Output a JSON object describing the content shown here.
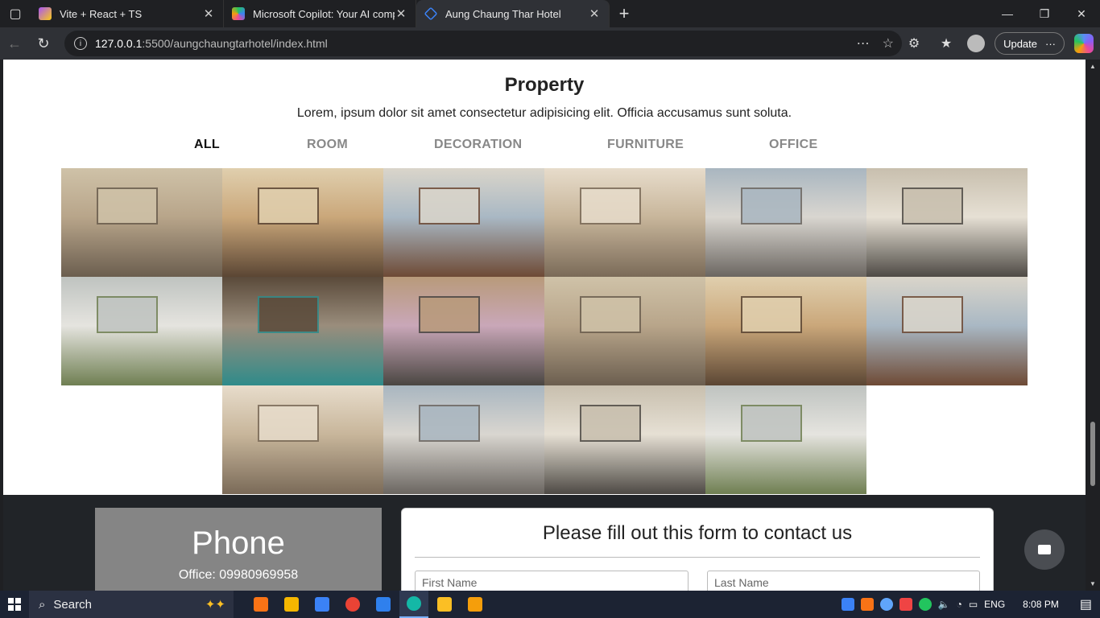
{
  "browser": {
    "tabs": [
      {
        "label": "Vite + React + TS",
        "icon": "vite-icon",
        "color": "#a855f7"
      },
      {
        "label": "Microsoft Copilot: Your AI compa",
        "icon": "copilot-icon",
        "color": "#22c55e"
      },
      {
        "label": "Aung Chaung Thar Hotel",
        "icon": "page-icon",
        "color": "#3b82f6"
      }
    ],
    "url_host": "127.0.0.1",
    "url_path": ":5500/aungchaungtarhotel/index.html",
    "update_label": "Update",
    "more_label": "···"
  },
  "page": {
    "title": "Property",
    "subtitle": "Lorem, ipsum dolor sit amet consectetur adipisicing elit. Officia accusamus sunt soluta.",
    "filters": [
      {
        "label": "ALL",
        "active": true
      },
      {
        "label": "ROOM",
        "active": false
      },
      {
        "label": "DECORATION",
        "active": false
      },
      {
        "label": "FURNITURE",
        "active": false
      },
      {
        "label": "OFFICE",
        "active": false
      }
    ],
    "gallery": [
      {
        "name": "living-room-photo",
        "colors": [
          "#b8a58a",
          "#6b5e4f",
          "#cfc2a8"
        ]
      },
      {
        "name": "kitchen-bar-photo",
        "colors": [
          "#caa77a",
          "#5b4634",
          "#e0cfae"
        ]
      },
      {
        "name": "open-kitchen-photo",
        "colors": [
          "#a9b8c4",
          "#6e4a35",
          "#dad5ca"
        ]
      },
      {
        "name": "lounge-photo",
        "colors": [
          "#c8b69b",
          "#7a6a58",
          "#e7dccb"
        ]
      },
      {
        "name": "bedroom-photo",
        "colors": [
          "#d9d6d0",
          "#6b6661",
          "#a9b6c0"
        ]
      },
      {
        "name": "bathroom-photo",
        "colors": [
          "#e6e0d4",
          "#4e4a45",
          "#c8bfae"
        ]
      },
      {
        "name": "sunroom-photo",
        "colors": [
          "#e5e4df",
          "#6f7f52",
          "#bfc3c0"
        ]
      },
      {
        "name": "billiard-room-photo",
        "colors": [
          "#9a8d7c",
          "#2f8b8a",
          "#5a4a3a"
        ]
      },
      {
        "name": "house-exterior-photo",
        "colors": [
          "#c9a7b8",
          "#4a4642",
          "#b89a7a"
        ]
      },
      {
        "name": "living-room-photo-2",
        "colors": [
          "#b8a58a",
          "#6b5e4f",
          "#cfc2a8"
        ]
      },
      {
        "name": "kitchen-bar-photo-2",
        "colors": [
          "#caa77a",
          "#5b4634",
          "#e0cfae"
        ]
      },
      {
        "name": "open-kitchen-photo-2",
        "colors": [
          "#a9b8c4",
          "#6e4a35",
          "#dad5ca"
        ]
      },
      {
        "name": "lounge-photo-2",
        "colors": [
          "#c8b69b",
          "#7a6a58",
          "#e7dccb"
        ]
      },
      {
        "name": "bedroom-photo-2",
        "colors": [
          "#d9d6d0",
          "#6b6661",
          "#a9b6c0"
        ]
      },
      {
        "name": "bathroom-photo-2",
        "colors": [
          "#e6e0d4",
          "#4e4a45",
          "#c8bfae"
        ]
      },
      {
        "name": "sunroom-photo-2",
        "colors": [
          "#e5e4df",
          "#6f7f52",
          "#bfc3c0"
        ]
      }
    ],
    "contact": {
      "phone_title": "Phone",
      "office_phone": "Office: 09980969958",
      "form_title": "Please fill out this form to contact us",
      "first_name_placeholder": "First Name",
      "last_name_placeholder": "Last Name"
    }
  },
  "taskbar": {
    "search_label": "Search",
    "lang": "ENG",
    "time": "8:08 PM",
    "apps": [
      {
        "name": "app-orange",
        "color": "#f97316"
      },
      {
        "name": "app-yellow",
        "color": "#f5b700"
      },
      {
        "name": "app-monitor",
        "color": "#3b82f6"
      },
      {
        "name": "chrome",
        "color": "#ea4335"
      },
      {
        "name": "vscode",
        "color": "#2f80ed"
      },
      {
        "name": "edge",
        "color": "#14b8a6",
        "active": true
      },
      {
        "name": "file-explorer",
        "color": "#fbbf24"
      },
      {
        "name": "security-shield",
        "color": "#f59e0b"
      }
    ]
  }
}
